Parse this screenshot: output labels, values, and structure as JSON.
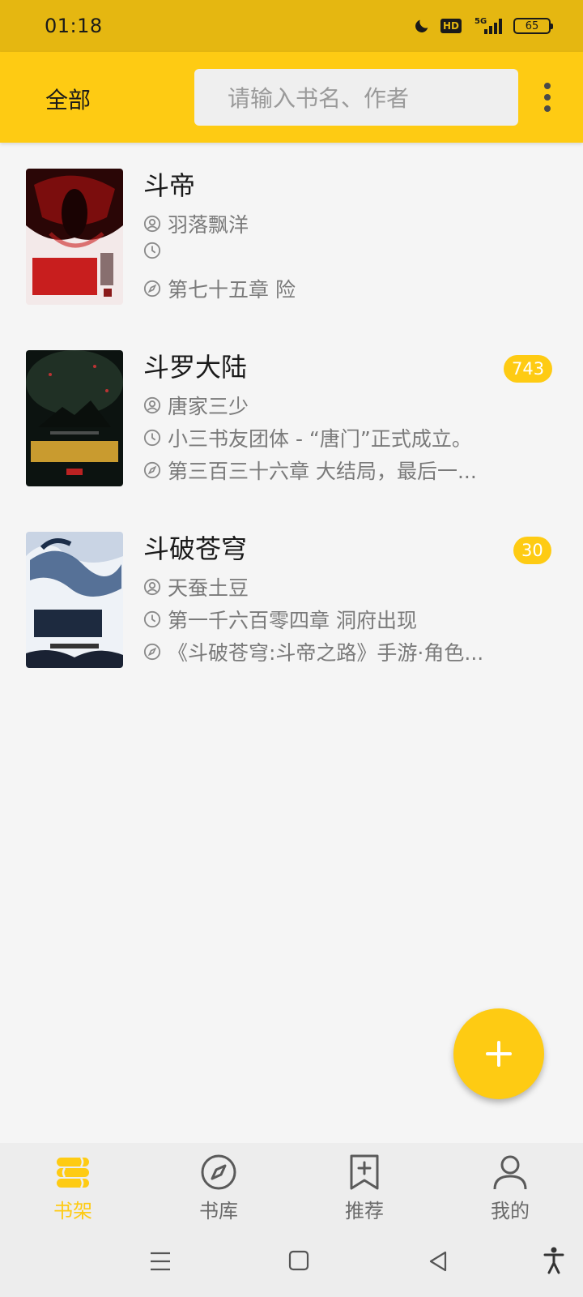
{
  "status_bar": {
    "time": "01:18",
    "network": "5G",
    "hd_label": "HD",
    "battery": "65",
    "icons": [
      "moon-icon",
      "hd-icon",
      "signal-5g-icon",
      "battery-icon"
    ]
  },
  "toolbar": {
    "filter_label": "全部",
    "search_placeholder": "请输入书名、作者",
    "more_icon": "more-vertical-icon"
  },
  "books": [
    {
      "title": "斗帝",
      "author": "羽落飘洋",
      "latest_update": "",
      "latest_read": "第七十五章 险",
      "unread": "",
      "cover_colors": [
        "#5a0a0a",
        "#c22",
        "#f3e6e6"
      ]
    },
    {
      "title": "斗罗大陆",
      "author": "唐家三少",
      "latest_update": "小三书友团体 - “唐门”正式成立。",
      "latest_read": "第三百三十六章 大结局，最后一...",
      "unread": "743",
      "cover_colors": [
        "#0e1512",
        "#2b3a2e",
        "#c99b2f"
      ]
    },
    {
      "title": "斗破苍穹",
      "author": "天蚕土豆",
      "latest_update": "第一千六百零四章 洞府出现",
      "latest_read": "《斗破苍穹:斗帝之路》手游·角色...",
      "unread": "30",
      "cover_colors": [
        "#e9eef5",
        "#3b5a86",
        "#1a2233"
      ]
    }
  ],
  "fab": {
    "icon": "plus-icon"
  },
  "bottom_nav": [
    {
      "label": "书架",
      "icon": "bookshelf-icon",
      "active": true
    },
    {
      "label": "书库",
      "icon": "compass-icon",
      "active": false
    },
    {
      "label": "推荐",
      "icon": "bookmark-add-icon",
      "active": false
    },
    {
      "label": "我的",
      "icon": "user-icon",
      "active": false
    }
  ],
  "colors": {
    "accent": "#fecb13",
    "status_bar": "#e5b711",
    "background": "#f5f5f5",
    "nav_background": "#ededed"
  }
}
